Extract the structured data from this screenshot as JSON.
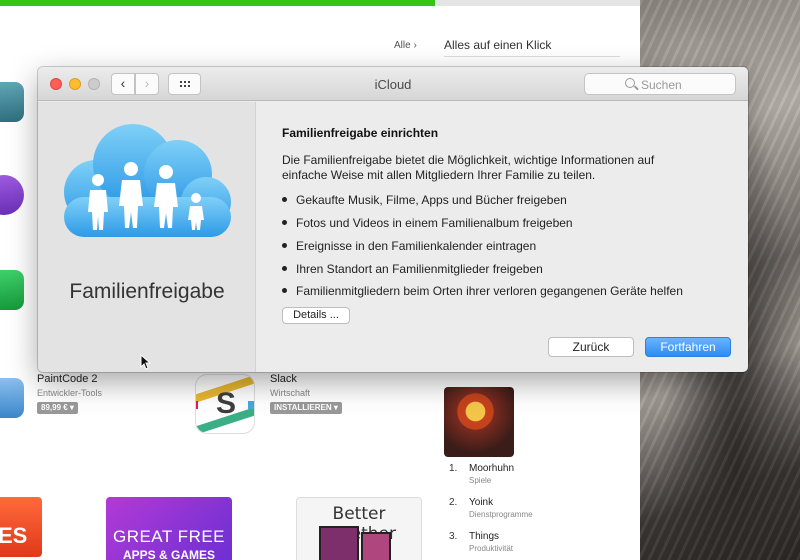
{
  "colors": {
    "accent": "#2a8df5",
    "progress": "#34c41a",
    "cloud_blue": "#4fb0ee"
  },
  "appstore": {
    "progress_fraction": 0.68,
    "all_link": "Alle",
    "section_title": "Alles auf einen Klick",
    "apps": [
      {
        "name": "PaintCode 2",
        "category": "Entwickler-Tools",
        "price": "89,99 €"
      },
      {
        "name": "Slack",
        "category": "Wirtschaft",
        "price": "INSTALLIEREN"
      }
    ],
    "top_list": [
      {
        "rank": "1.",
        "name": "Moorhuhn",
        "category": "Spiele"
      },
      {
        "rank": "2.",
        "name": "Yoink",
        "category": "Dienstprogramme"
      },
      {
        "rank": "3.",
        "name": "Things",
        "category": "Produktivität"
      }
    ],
    "banners": {
      "left_fragment": "ES",
      "free_apps_line1": "GREAT FREE",
      "free_apps_line2": "APPS & GAMES",
      "better_together": "Better Together"
    }
  },
  "icloud": {
    "title": "iCloud",
    "search_placeholder": "Suchen",
    "family_label": "Familienfreigabe",
    "heading": "Familienfreigabe einrichten",
    "intro": "Die Familienfreigabe bietet die Möglichkeit, wichtige Informationen auf einfache Weise mit allen Mitgliedern Ihrer Familie zu teilen.",
    "bullets": [
      "Gekaufte Musik, Filme, Apps und Bücher freigeben",
      "Fotos und Videos in einem Familienalbum freigeben",
      "Ereignisse in den Familienkalender eintragen",
      "Ihren Standort an Familienmitglieder freigeben",
      "Familienmitgliedern beim Orten ihrer verloren gegangenen Geräte helfen"
    ],
    "details_button": "Details ...",
    "back_button": "Zurück",
    "continue_button": "Fortfahren"
  }
}
